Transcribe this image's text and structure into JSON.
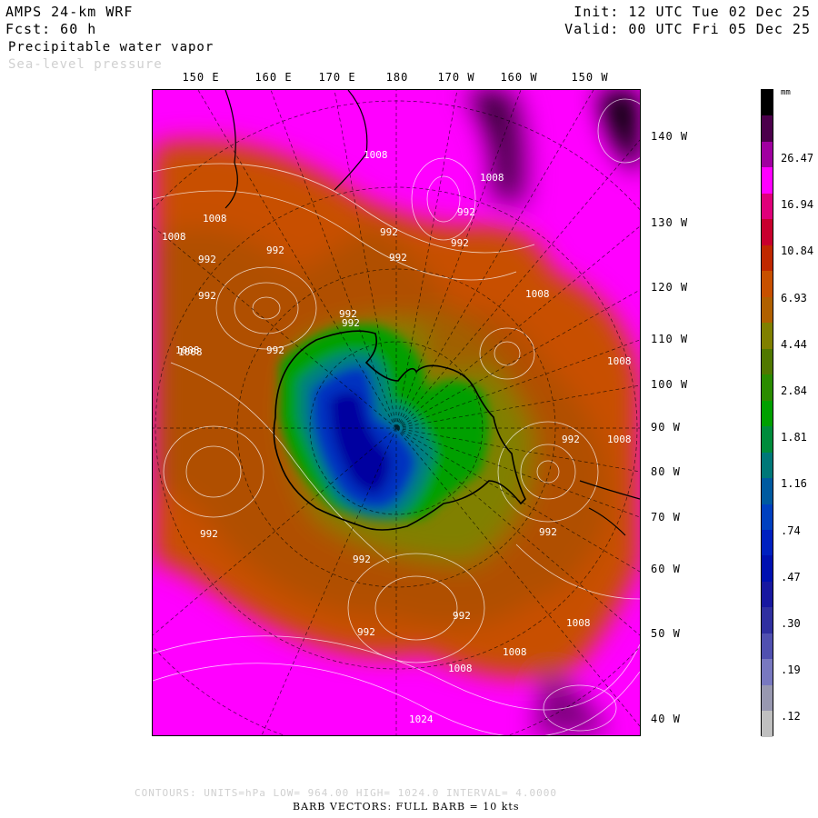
{
  "header": {
    "model": "AMPS 24-km WRF",
    "forecast": "Fcst:   60 h",
    "field1": "Precipitable water vapor",
    "field2": "Sea-level pressure",
    "init": "Init: 12 UTC Tue 02 Dec 25",
    "valid": "Valid: 00 UTC Fri 05 Dec 25"
  },
  "map": {
    "lon_labels": [
      "150 E",
      "160 E",
      "170 E",
      "180",
      "170 W",
      "160 W",
      "150 W"
    ],
    "lat_labels": [
      "140 W",
      "130 W",
      "120 W",
      "110 W",
      "100 W",
      "90 W",
      "80 W",
      "70 W",
      "60 W",
      "50 W",
      "40 W"
    ],
    "isobar_labels": [
      "1008",
      "992",
      "1008",
      "1008",
      "992",
      "992",
      "992",
      "992",
      "992",
      "1008",
      "992",
      "992",
      "1008",
      "992",
      "1008",
      "992",
      "1008",
      "992",
      "992",
      "1008",
      "1008",
      "992",
      "1008",
      "1024",
      "1008",
      "992",
      "992",
      "1008",
      "992"
    ],
    "colors": {
      "pink": "#ff00ff",
      "magenta": "#c000c0",
      "purple": "#800080",
      "black": "#000000",
      "orange": "#c85000",
      "brown": "#a05000",
      "olive": "#808000",
      "green": "#00a000",
      "teal": "#008080",
      "blue": "#0030c0",
      "navy": "#0000a0"
    }
  },
  "colorbar": {
    "unit": "mm",
    "labels": [
      "26.47",
      "16.94",
      "10.84",
      "6.93",
      "4.44",
      "2.84",
      "1.81",
      "1.16",
      ".74",
      ".47",
      ".30",
      ".19",
      ".12"
    ],
    "colors": [
      "#000000",
      "#4b004b",
      "#a000a0",
      "#ff00ff",
      "#e0007a",
      "#c8002d",
      "#c02800",
      "#c85000",
      "#b06000",
      "#808000",
      "#507800",
      "#2a8c00",
      "#00a000",
      "#008c3c",
      "#007878",
      "#005aa0",
      "#0040c0",
      "#0020c0",
      "#0010b0",
      "#1818a0",
      "#3030a0",
      "#5050b0",
      "#7878c0",
      "#9898b0",
      "#c0c0c0"
    ]
  },
  "footer": {
    "contours": "CONTOURS:  UNITS=hPa  LOW=  964.00      HIGH=  1024.0      INTERVAL=   4.0000",
    "barbs": "BARB VECTORS:  FULL BARB = 10 kts"
  }
}
